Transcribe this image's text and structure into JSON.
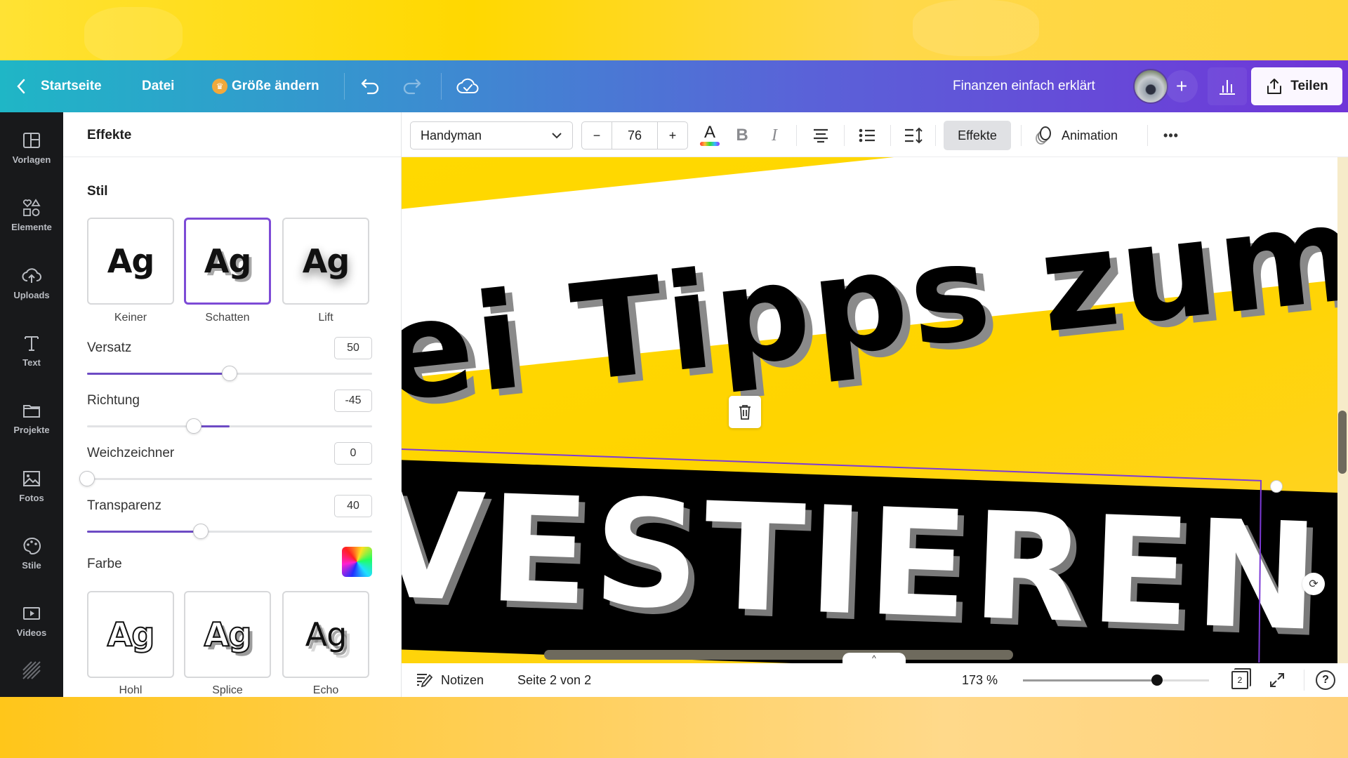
{
  "topbar": {
    "home_label": "Startseite",
    "file_label": "Datei",
    "resize_label": "Größe ändern",
    "project_title": "Finanzen einfach erklärt",
    "share_label": "Teilen",
    "icons": [
      "chevron-left-icon",
      "crown-icon",
      "undo-icon",
      "redo-icon",
      "cloud-check-icon",
      "plus-icon",
      "stats-icon",
      "share-icon"
    ]
  },
  "rail": {
    "items": [
      {
        "label": "Vorlagen",
        "icon": "templates-icon"
      },
      {
        "label": "Elemente",
        "icon": "elements-icon"
      },
      {
        "label": "Uploads",
        "icon": "upload-cloud-icon"
      },
      {
        "label": "Text",
        "icon": "text-icon"
      },
      {
        "label": "Projekte",
        "icon": "folder-icon"
      },
      {
        "label": "Fotos",
        "icon": "image-icon"
      },
      {
        "label": "Stile",
        "icon": "palette-icon"
      },
      {
        "label": "Videos",
        "icon": "video-icon"
      }
    ]
  },
  "panel": {
    "title": "Effekte",
    "style_section": "Stil",
    "styles_top": [
      {
        "label": "Keiner",
        "preview": "Ag",
        "selected": false
      },
      {
        "label": "Schatten",
        "preview": "Ag",
        "selected": true
      },
      {
        "label": "Lift",
        "preview": "Ag",
        "selected": false
      }
    ],
    "controls": [
      {
        "label": "Versatz",
        "value": "50",
        "fraction": 0.5,
        "fill_from": 0.0
      },
      {
        "label": "Richtung",
        "value": "-45",
        "fraction": 0.375,
        "fill_from": 0.5
      },
      {
        "label": "Weichzeichner",
        "value": "0",
        "fraction": 0.0,
        "fill_from": 0.0
      },
      {
        "label": "Transparenz",
        "value": "40",
        "fraction": 0.4,
        "fill_from": 0.0
      }
    ],
    "color_label": "Farbe",
    "styles_bottom": [
      {
        "label": "Hohl",
        "preview": "Ag"
      },
      {
        "label": "Splice",
        "preview": "Ag"
      },
      {
        "label": "Echo",
        "preview": "Ag"
      }
    ]
  },
  "toolbar": {
    "font_name": "Handyman",
    "font_size": "76",
    "minus": "−",
    "plus": "+",
    "bold": "B",
    "italic": "I",
    "text_color_letter": "A",
    "effects_label": "Effekte",
    "animation_label": "Animation",
    "more": "•••"
  },
  "canvas": {
    "line1": "ei Tipps zum",
    "line2": "VESTIEREN"
  },
  "bottombar": {
    "notes_label": "Notizen",
    "page_info": "Seite 2 von 2",
    "zoom_label": "173 %",
    "zoom_fraction": 0.72,
    "page_count": "2",
    "help": "?"
  },
  "colors": {
    "accent": "#7d4bd6",
    "slider_fill": "#6d4bc4",
    "rail_bg": "#18191b",
    "canvas_yellow": "#ffd900"
  }
}
